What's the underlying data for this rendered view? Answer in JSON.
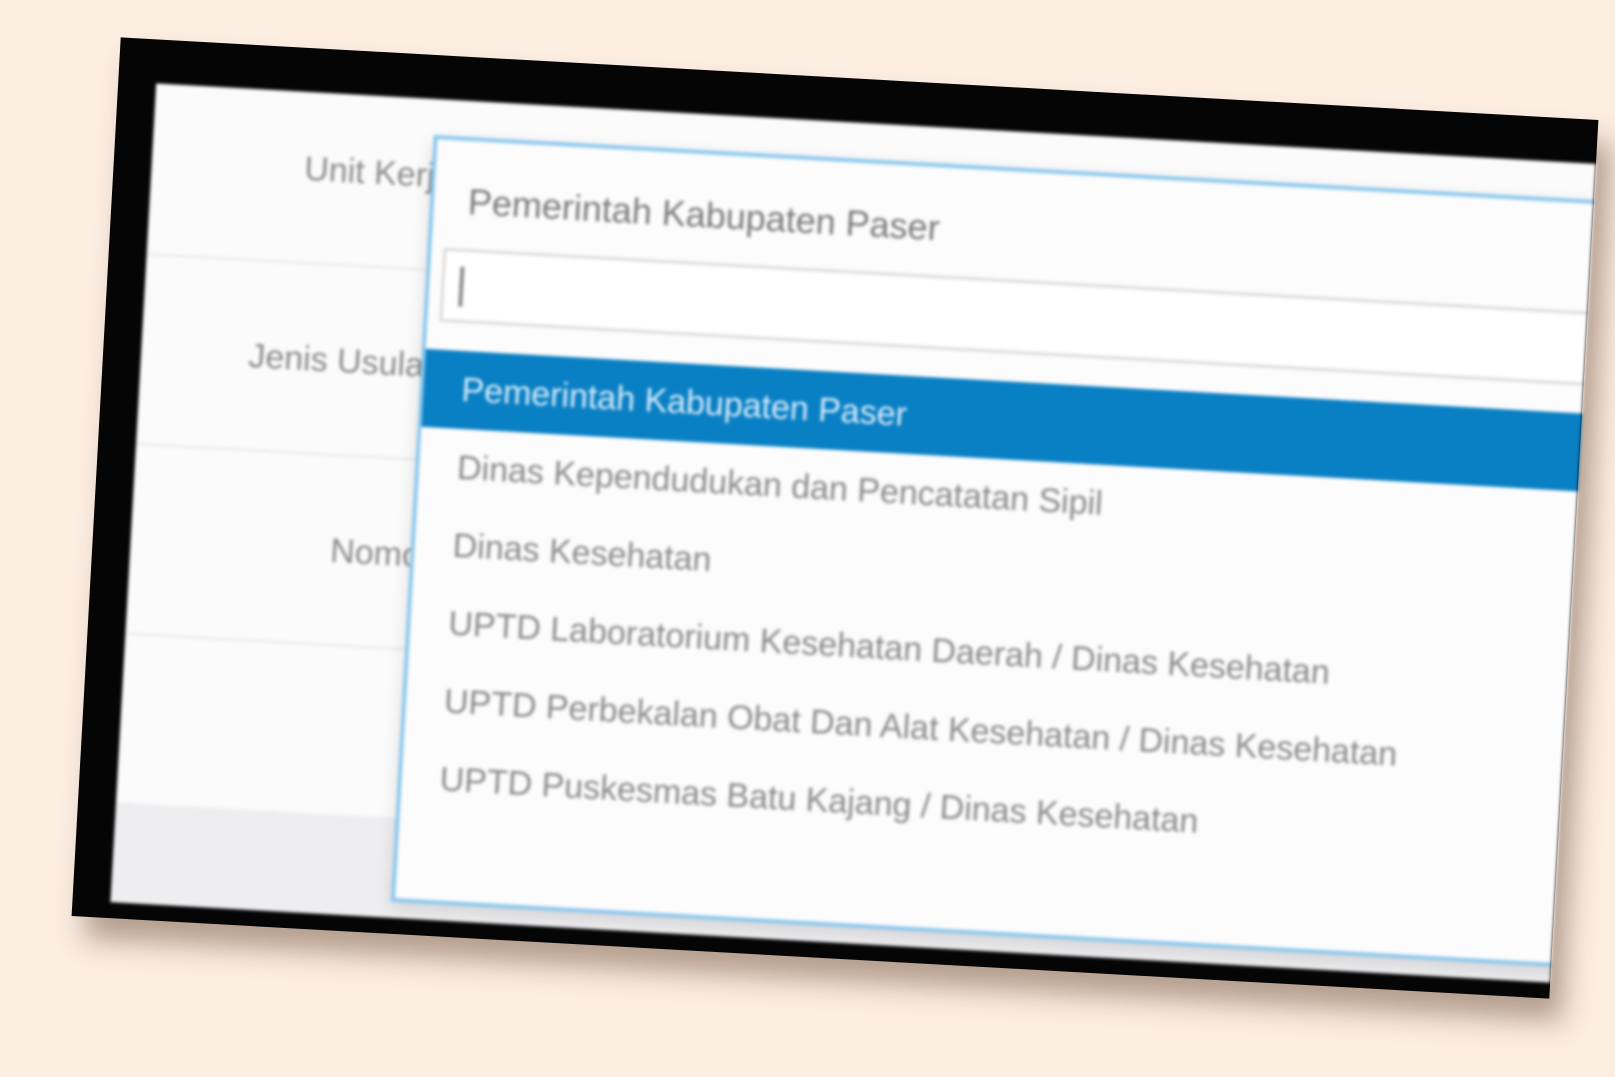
{
  "form": {
    "unit_kerja_label": "Unit Kerja",
    "jenis_usulan_label": "Jenis Usulan",
    "nomor_label": "Nomor"
  },
  "select": {
    "selected_value": "Pemerintah Kabupaten Paser",
    "search_value": "",
    "options": [
      {
        "label": "Pemerintah Kabupaten Paser",
        "highlighted": true
      },
      {
        "label": "Dinas Kependudukan dan Pencatatan Sipil",
        "highlighted": false
      },
      {
        "label": "Dinas Kesehatan",
        "highlighted": false
      },
      {
        "label": "UPTD Laboratorium Kesehatan Daerah / Dinas Kesehatan",
        "highlighted": false
      },
      {
        "label": "UPTD Perbekalan Obat Dan Alat Kesehatan / Dinas Kesehatan",
        "highlighted": false
      },
      {
        "label": "UPTD Puskesmas Batu Kajang / Dinas Kesehatan",
        "highlighted": false
      }
    ]
  },
  "colors": {
    "highlight": "#0a80c4",
    "focus_border": "#8cc8ee",
    "background": "#fdeee2"
  }
}
